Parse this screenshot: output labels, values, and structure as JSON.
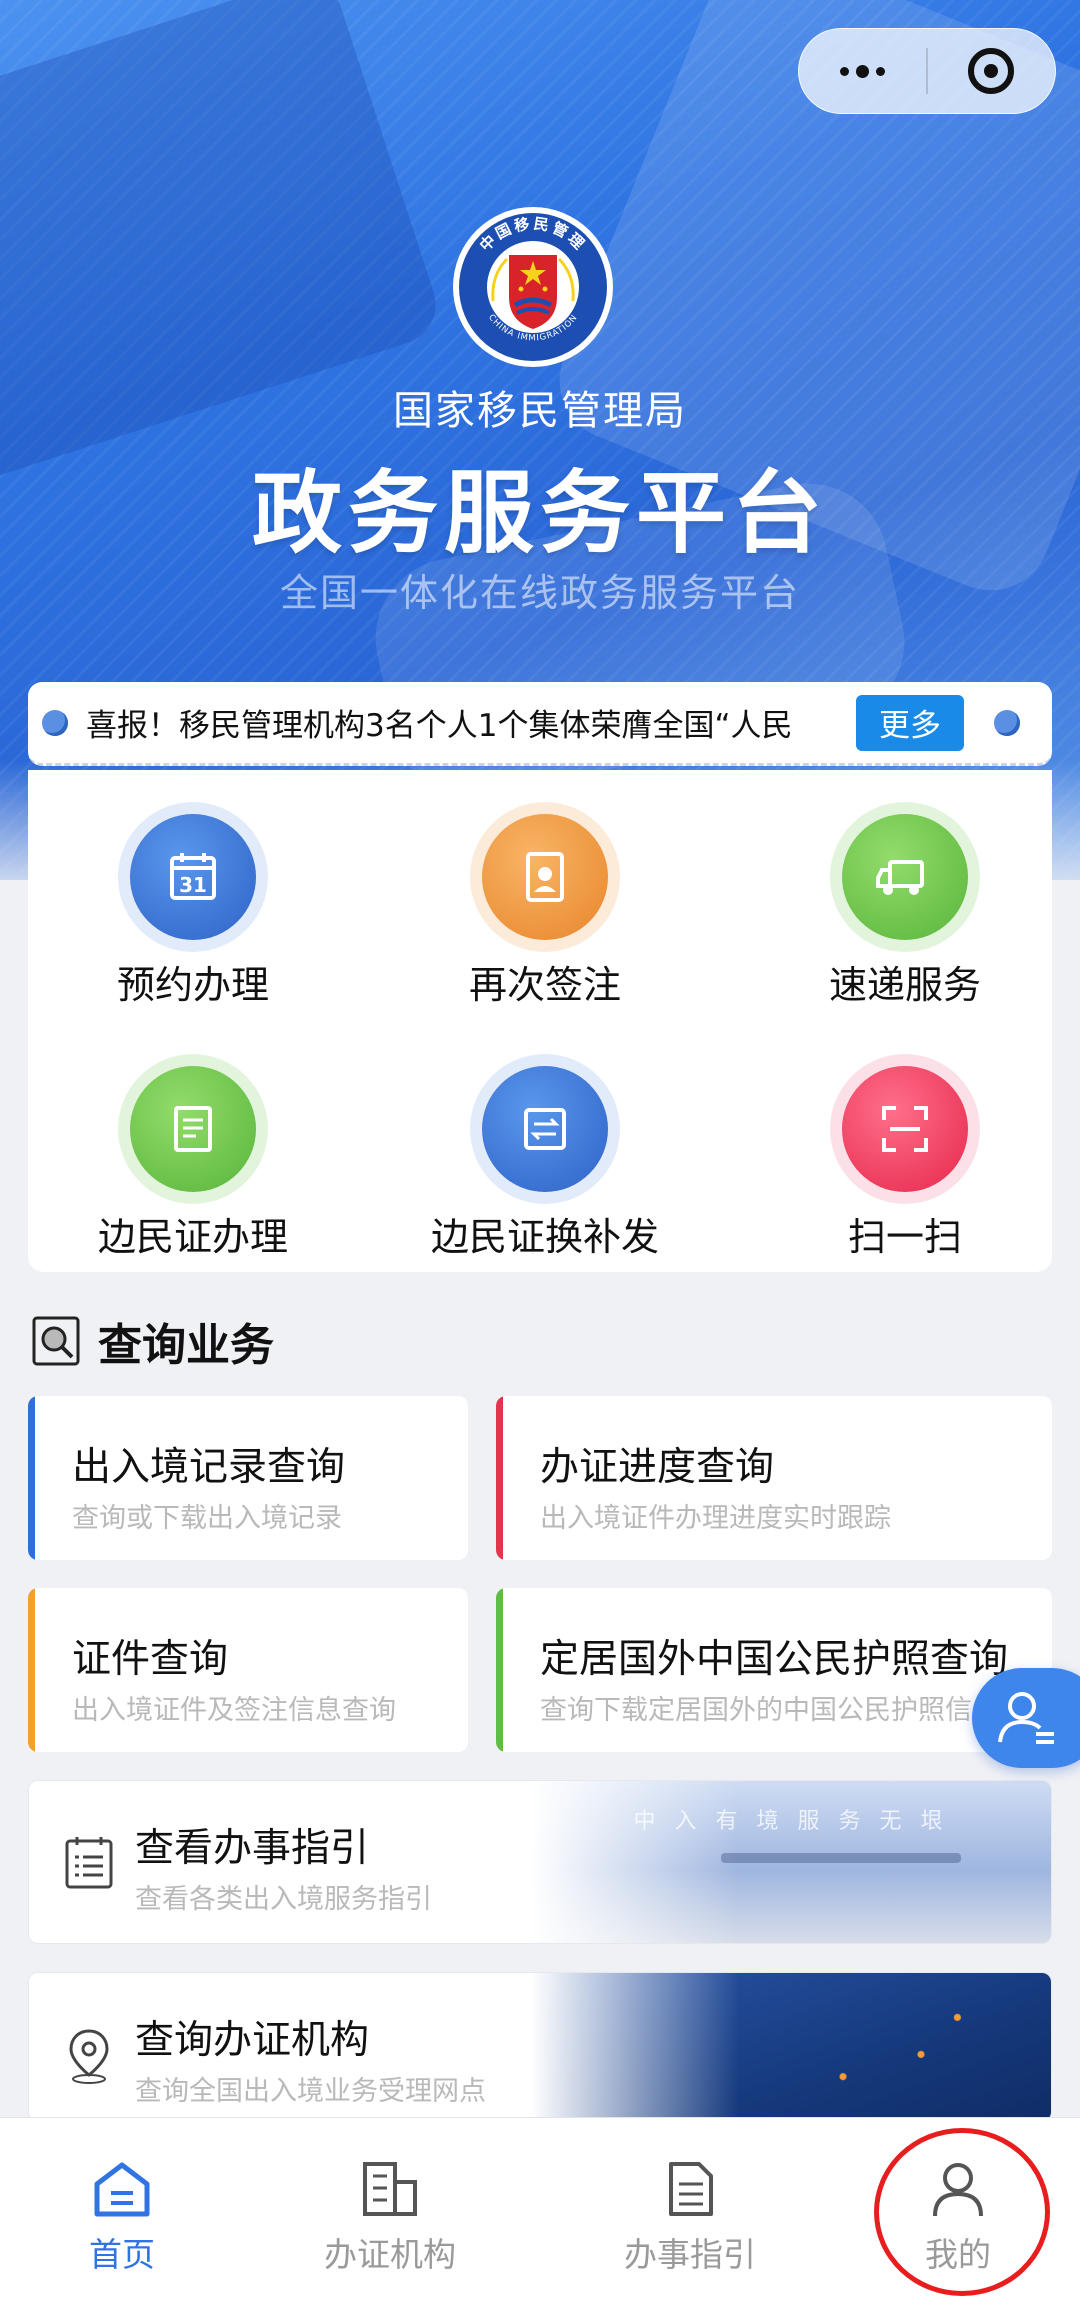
{
  "header": {
    "agency_name": "国家移民管理局",
    "title": "政务服务平台",
    "subtitle": "全国一体化在线政务服务平台",
    "emblem": {
      "top_text": "中国移民管理",
      "bottom_text": "CHINA IMMIGRATION"
    }
  },
  "notice": {
    "text": "喜报！移民管理机构3名个人1个集体荣膺全国“人民",
    "more_label": "更多"
  },
  "quick_actions": [
    {
      "label": "预约办理",
      "icon": "calendar-icon"
    },
    {
      "label": "再次签注",
      "icon": "id-card-icon"
    },
    {
      "label": "速递服务",
      "icon": "delivery-truck-icon"
    },
    {
      "label": "边民证办理",
      "icon": "document-icon"
    },
    {
      "label": "边民证换补发",
      "icon": "swap-icon"
    },
    {
      "label": "扫一扫",
      "icon": "scan-icon"
    }
  ],
  "query_section": {
    "title": "查询业务",
    "cards": [
      {
        "title": "出入境记录查询",
        "desc": "查询或下载出入境记录",
        "accent": "#2f6fd6"
      },
      {
        "title": "办证进度查询",
        "desc": "出入境证件办理进度实时跟踪",
        "accent": "#e8334f"
      },
      {
        "title": "证件查询",
        "desc": "出入境证件及签注信息查询",
        "accent": "#f0a12e"
      },
      {
        "title": "定居国外中国公民护照查询",
        "desc": "查询下载定居国外的中国公民护照信",
        "accent": "#5fbe3f"
      }
    ]
  },
  "guides": [
    {
      "title": "查看办事指引",
      "desc": "查看各类出入境服务指引",
      "banner_text": "中 入 有 境 服 务 无 垠"
    },
    {
      "title": "查询办证机构",
      "desc": "查询全国出入境业务受理网点"
    }
  ],
  "tabbar": [
    {
      "label": "首页",
      "icon": "home-icon",
      "active": true
    },
    {
      "label": "办证机构",
      "icon": "building-icon",
      "active": false
    },
    {
      "label": "办事指引",
      "icon": "doc-list-icon",
      "active": false
    },
    {
      "label": "我的",
      "icon": "user-icon",
      "active": false
    }
  ],
  "colors": {
    "primary": "#2f74e2",
    "annotation_circle": "#e81e1e"
  }
}
